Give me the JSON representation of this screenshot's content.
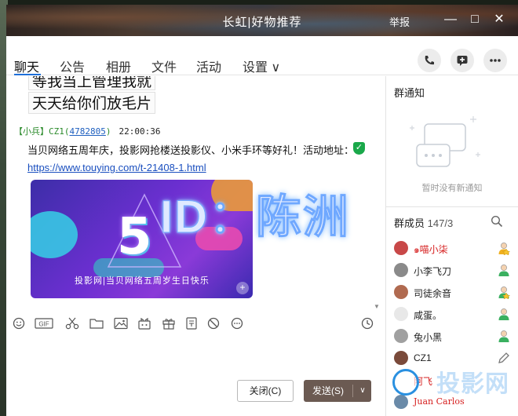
{
  "window": {
    "title": "长虹|好物推荐",
    "report_label": "举报",
    "minimize_label": "—",
    "maximize_label": "□",
    "close_label": "✕"
  },
  "tabs": [
    {
      "label": "聊天"
    },
    {
      "label": "公告"
    },
    {
      "label": "相册"
    },
    {
      "label": "文件"
    },
    {
      "label": "活动"
    },
    {
      "label": "设置 ∨"
    }
  ],
  "chat": {
    "handwritten_line1": "等我当上管理我就",
    "handwritten_line2": "天天给你们放毛片",
    "sender_name": "【小兵】CZ1",
    "sender_qq_open": "(",
    "sender_qq": "4782805",
    "sender_qq_close": ")",
    "sender_time": "22:00:36",
    "message": "当贝网络五周年庆，投影网抢楼送投影仪、小米手环等好礼！活动地址：",
    "link": "https://www.touying.com/t-21408-1.html",
    "banner_big": "5",
    "banner_caption": "投影网|当贝网络五周岁生日快乐",
    "watermark_id": "ID：陈洲"
  },
  "toolbar_icons": [
    "emoji-icon",
    "gif-icon",
    "scissors-icon",
    "folder-icon",
    "image-icon",
    "gift-box-icon",
    "present-icon",
    "document-icon",
    "block-icon",
    "more-icon",
    "history-icon"
  ],
  "actions": {
    "close_label": "关闭(C)",
    "send_label": "发送(S)",
    "send_menu": "∨"
  },
  "notice": {
    "title": "群通知",
    "empty_text": "暂时没有新通知"
  },
  "members": {
    "title": "群成员",
    "count": "147/3",
    "list": [
      {
        "name": "๑喵小柒",
        "color": "#d62020"
      },
      {
        "name": "小李飞刀",
        "color": "#222222"
      },
      {
        "name": "司徒余音",
        "color": "#222222"
      },
      {
        "name": "咸蛋。",
        "color": "#222222"
      },
      {
        "name": "兔小黑",
        "color": "#222222"
      },
      {
        "name": "CZ1",
        "color": "#222222"
      },
      {
        "name": "阿飞",
        "color": "#d62020"
      },
      {
        "name": "Juan Carlos",
        "color": "#d62020"
      }
    ]
  },
  "watermark_site": "投影网"
}
